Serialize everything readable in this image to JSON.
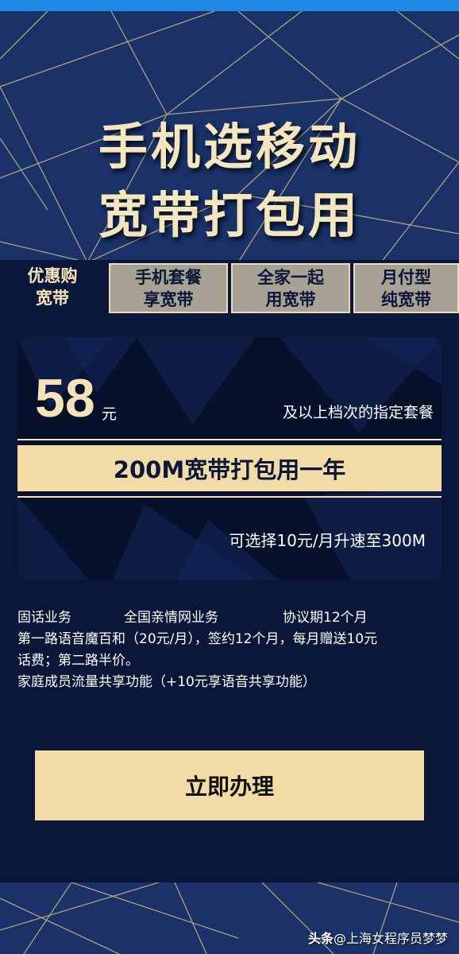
{
  "hero": {
    "title_line1": "手机选移动",
    "title_line2": "宽带打包用"
  },
  "tabs": [
    {
      "line1": "优惠购",
      "line2": "宽带",
      "active": true
    },
    {
      "line1": "手机套餐",
      "line2": "享宽带",
      "active": false
    },
    {
      "line1": "全家一起",
      "line2": "用宽带",
      "active": false
    },
    {
      "line1": "月付型",
      "line2": "纯宽带",
      "active": false
    }
  ],
  "offer": {
    "price": "58",
    "unit": "元",
    "note": "及以上档次的指定套餐",
    "band_text": "200M宽带打包用一年",
    "upgrade_text": "可选择10元/月升速至300M"
  },
  "details": {
    "row1": [
      "固话业务",
      "全国亲情网业务",
      "协议期12个月"
    ],
    "row2": "第一路语音魔百和（20元/月），签约12个月，每月赠送10元",
    "row3": "话费；第二路半价。",
    "row4": "家庭成员流量共享功能（+10元享语音共享功能）"
  },
  "apply_button": "立即办理",
  "watermark": {
    "brand": "头条",
    "handle": "@上海女程序员梦梦"
  },
  "colors": {
    "gold": "#f3dba8",
    "navy": "#0a1738",
    "hero_blue": "#1a3268",
    "topbar": "#1e88e5"
  }
}
